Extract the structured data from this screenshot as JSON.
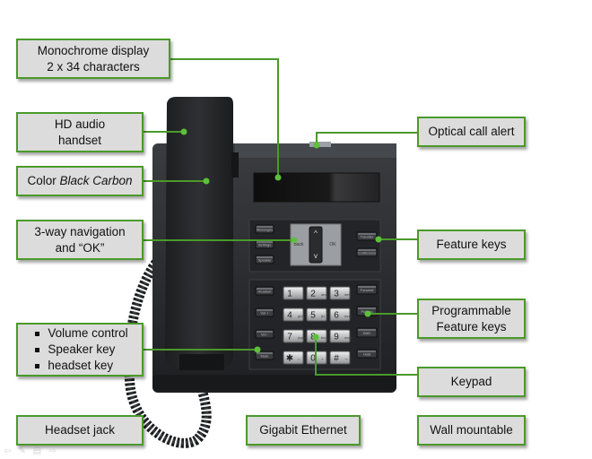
{
  "callouts": {
    "monochrome_display": {
      "line1": "Monochrome display",
      "line2": "2 x 34 characters"
    },
    "hd_audio_handset": {
      "line1": "HD audio",
      "line2": "handset"
    },
    "color": {
      "prefix": "Color ",
      "emphasis": "Black Carbon"
    },
    "navigation": {
      "line1": "3-way navigation",
      "line2": "and “OK”"
    },
    "controls": {
      "items": [
        "Volume control",
        "Speaker key",
        "headset key"
      ]
    },
    "headset_jack": {
      "label": "Headset jack"
    },
    "gigabit_ethernet": {
      "label": "Gigabit Ethernet"
    },
    "wall_mountable": {
      "label": "Wall mountable"
    },
    "optical_call_alert": {
      "label": "Optical call alert"
    },
    "feature_keys": {
      "label": "Feature keys"
    },
    "programmable_feature_keys": {
      "line1": "Programmable",
      "line2": "Feature keys"
    },
    "keypad": {
      "label": "Keypad"
    }
  },
  "phone": {
    "left_keys": [
      "Messages",
      "Settings",
      "Speaker"
    ],
    "left_lower_keys": [
      "Headset",
      "Vol +",
      "Vol -",
      "Mute"
    ],
    "nav": {
      "back": "Back",
      "ok": "OK",
      "up": "^",
      "down": "v"
    },
    "right_keys": [
      "Transfer",
      "Conference"
    ],
    "prog_keys": [
      "Forward",
      "Pick up",
      "DND"
    ],
    "hold_key": "Hold",
    "keypad": [
      {
        "digit": "1",
        "sub": ""
      },
      {
        "digit": "2",
        "sub": "abc"
      },
      {
        "digit": "3",
        "sub": "def"
      },
      {
        "digit": "4",
        "sub": "ghi"
      },
      {
        "digit": "5",
        "sub": "jkl"
      },
      {
        "digit": "6",
        "sub": "mno"
      },
      {
        "digit": "7",
        "sub": "pqrs"
      },
      {
        "digit": "8",
        "sub": "tuv"
      },
      {
        "digit": "9",
        "sub": "wxyz"
      },
      {
        "digit": "✱",
        "sub": "○"
      },
      {
        "digit": "0",
        "sub": "+"
      },
      {
        "digit": "#",
        "sub": "⊸"
      }
    ]
  },
  "colors": {
    "accent": "#4a9a2a",
    "callout_bg": "#dcdcdc",
    "phone_body": "#2b2d30"
  }
}
